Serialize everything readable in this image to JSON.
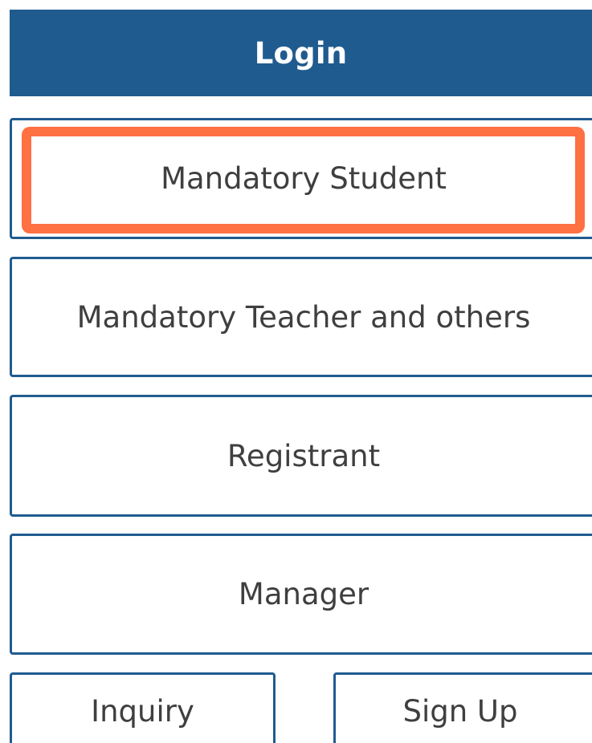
{
  "header": {
    "title": "Login"
  },
  "login_options": [
    {
      "label": "Mandatory Student",
      "highlighted": true
    },
    {
      "label": "Mandatory Teacher and others",
      "highlighted": false
    },
    {
      "label": "Registrant",
      "highlighted": false
    },
    {
      "label": "Manager",
      "highlighted": false
    }
  ],
  "footer": {
    "inquiry_label": "Inquiry",
    "signup_label": "Sign Up"
  },
  "colors": {
    "header_bg": "#1f5b8f",
    "border": "#1f5b8f",
    "highlight": "#ff7043",
    "text": "#3f3f3f"
  }
}
